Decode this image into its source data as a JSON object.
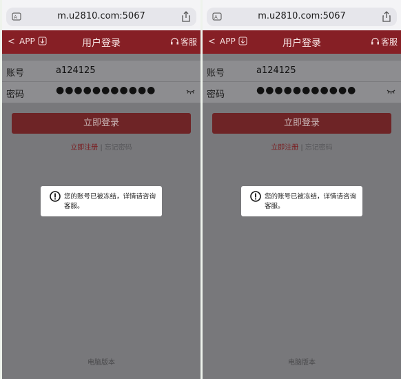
{
  "screens": [
    {
      "url": "m.u2810.com:5067",
      "header": {
        "back": "<",
        "app_label": "APP",
        "title": "用户登录",
        "service": "客服"
      },
      "form": {
        "account_label": "账号",
        "account_value": "a124125",
        "password_label": "密码",
        "password_value": "●●●●●●●●●●●"
      },
      "login_button": "立即登录",
      "links": {
        "register": "立即注册",
        "separator": "|",
        "forgot": "忘记密码"
      },
      "toast": {
        "message": "您的账号已被冻结，详情请咨询客服。"
      },
      "footer": "电脑版本"
    },
    {
      "url": "m.u2810.com:5067",
      "header": {
        "back": "<",
        "app_label": "APP",
        "title": "用户登录",
        "service": "客服"
      },
      "form": {
        "account_label": "账号",
        "account_value": "a124125",
        "password_label": "密码",
        "password_value": "●●●●●●●●●●●"
      },
      "login_button": "立即登录",
      "links": {
        "register": "立即注册",
        "separator": "|",
        "forgot": "忘记密码"
      },
      "toast": {
        "message": "您的账号已被冻结，详情请咨询客服。"
      },
      "footer": "电脑版本"
    }
  ],
  "colors": {
    "header": "#861f25",
    "overlay": "#78787b",
    "button": "#6e2426",
    "link": "#7a1c1f"
  }
}
